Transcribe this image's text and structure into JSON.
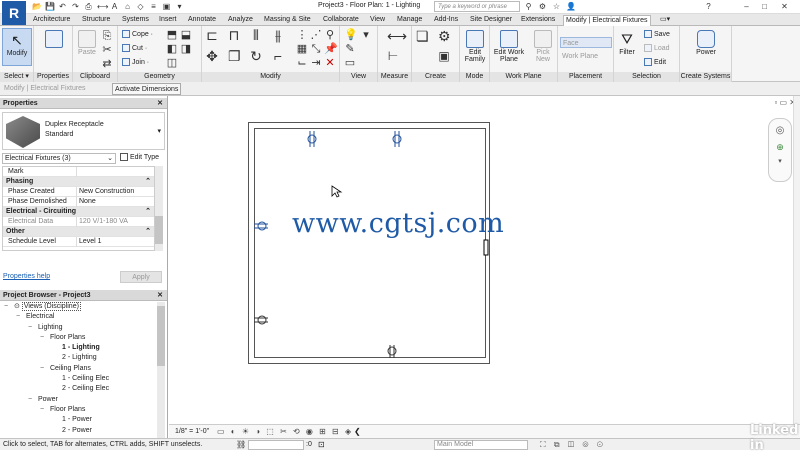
{
  "app": {
    "logo_letter": "R",
    "title": "Project3 - Floor Plan: 1 - Lighting"
  },
  "quick_access": [
    "open-icon",
    "save-icon",
    "undo-icon",
    "redo-icon",
    "print-icon",
    "measure-icon",
    "text-icon",
    "3d-view-icon",
    "section-icon",
    "thin-lines-icon",
    "close-windows-icon",
    "switch-windows-icon"
  ],
  "search": {
    "placeholder": "Type a keyword or phrase"
  },
  "tabs": [
    "Architecture",
    "Structure",
    "Systems",
    "Insert",
    "Annotate",
    "Analyze",
    "Massing & Site",
    "Collaborate",
    "View",
    "Manage",
    "Add-Ins",
    "Site Designer",
    "Extensions",
    "Modify | Electrical Fixtures"
  ],
  "ribbon": {
    "select": {
      "modify": "Modify",
      "select_label": "Select ▾"
    },
    "properties": {
      "label": "Properties"
    },
    "clipboard": {
      "paste": "Paste",
      "label": "Clipboard"
    },
    "geometry": {
      "cope": "Cope ·",
      "cut": "Cut ·",
      "join": "Join ·",
      "label": "Geometry"
    },
    "modify": {
      "label": "Modify"
    },
    "view": {
      "label": "View"
    },
    "measure": {
      "label": "Measure"
    },
    "create": {
      "label": "Create"
    },
    "mode": {
      "edit_family": "Edit Family",
      "label": "Mode"
    },
    "work_plane": {
      "edit_work_plane": "Edit Work Plane",
      "pick_new": "Pick New",
      "label": "Work Plane"
    },
    "placement": {
      "face": "Face",
      "work_plane": "Work Plane",
      "label": "Placement"
    },
    "selection": {
      "filter": "Filter",
      "save": "Save",
      "load": "Load",
      "edit": "Edit",
      "label": "Selection"
    },
    "create_systems": {
      "power": "Power",
      "label": "Create Systems"
    }
  },
  "context_bar": {
    "label": "Modify | Electrical Fixtures",
    "activate_dimensions": "Activate Dimensions"
  },
  "properties_panel": {
    "title": "Properties",
    "type_name": "Duplex Receptacle",
    "type_sub": "Standard",
    "filter": "Electrical Fixtures (3)",
    "edit_type": "Edit Type",
    "rows": [
      {
        "kind": "row",
        "k": "Mark",
        "v": ""
      },
      {
        "kind": "section",
        "k": "Phasing"
      },
      {
        "kind": "row",
        "k": "Phase Created",
        "v": "New Construction"
      },
      {
        "kind": "row",
        "k": "Phase Demolished",
        "v": "None"
      },
      {
        "kind": "section",
        "k": "Electrical - Circuiting"
      },
      {
        "kind": "row",
        "k": "Electrical Data",
        "v": "120 V/1-180 VA"
      },
      {
        "kind": "section",
        "k": "Other"
      },
      {
        "kind": "row",
        "k": "Schedule Level",
        "v": "Level 1"
      }
    ],
    "help_link": "Properties help",
    "apply": "Apply"
  },
  "project_browser": {
    "title": "Project Browser - Project3",
    "nodes": [
      {
        "depth": 0,
        "t": "Views (Discipline)",
        "sign": "−"
      },
      {
        "depth": 1,
        "t": "Electrical",
        "sign": "−"
      },
      {
        "depth": 2,
        "t": "Lighting",
        "sign": "−"
      },
      {
        "depth": 3,
        "t": "Floor Plans",
        "sign": "−"
      },
      {
        "depth": 4,
        "t": "1 - Lighting",
        "sign": "",
        "bold": true
      },
      {
        "depth": 4,
        "t": "2 - Lighting",
        "sign": ""
      },
      {
        "depth": 3,
        "t": "Ceiling Plans",
        "sign": "−"
      },
      {
        "depth": 4,
        "t": "1 - Ceiling Elec",
        "sign": ""
      },
      {
        "depth": 4,
        "t": "2 - Ceiling Elec",
        "sign": ""
      },
      {
        "depth": 2,
        "t": "Power",
        "sign": "−"
      },
      {
        "depth": 3,
        "t": "Floor Plans",
        "sign": "−"
      },
      {
        "depth": 4,
        "t": "1 - Power",
        "sign": ""
      },
      {
        "depth": 4,
        "t": "2 - Power",
        "sign": ""
      }
    ]
  },
  "canvas": {
    "watermark": "www.cgtsj.com"
  },
  "view_bar": {
    "scale": "1/8\" = 1'-0\""
  },
  "status": {
    "text": "Click to select, TAB for alternates, CTRL adds, SHIFT unselects.",
    "workset": "Main Model",
    "zero": ":0"
  },
  "branding": {
    "text": "Linked in"
  },
  "colors": {
    "accent": "#1f5aa6",
    "fixture": "#1f4f9a"
  }
}
